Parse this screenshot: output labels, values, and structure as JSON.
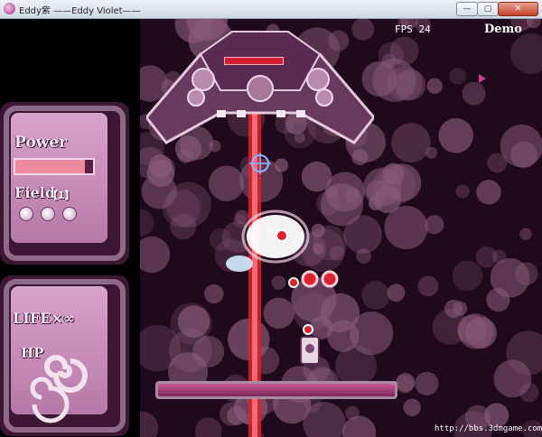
{
  "window": {
    "title": "Eddy紫 ——Eddy Violet——",
    "min_label": "—",
    "max_label": "▢",
    "close_label": "✕"
  },
  "hud": {
    "fps_label": "FPS  24",
    "mode_label": "Demo"
  },
  "left_panel": {
    "power_label": "Power",
    "power_level": 0.9,
    "field_label": "Field",
    "field_count": "【1】",
    "field_orbs": 3,
    "life_label": "LIFE×∞",
    "hp_label": "HP"
  },
  "watermark": "http://bbs.3dmgame.com/",
  "colors": {
    "background": "#1e0a1a",
    "bubble": "#8a5a78",
    "beam": "#e0202e",
    "panel": "#b678a6",
    "boss": "#6a3a5e"
  }
}
